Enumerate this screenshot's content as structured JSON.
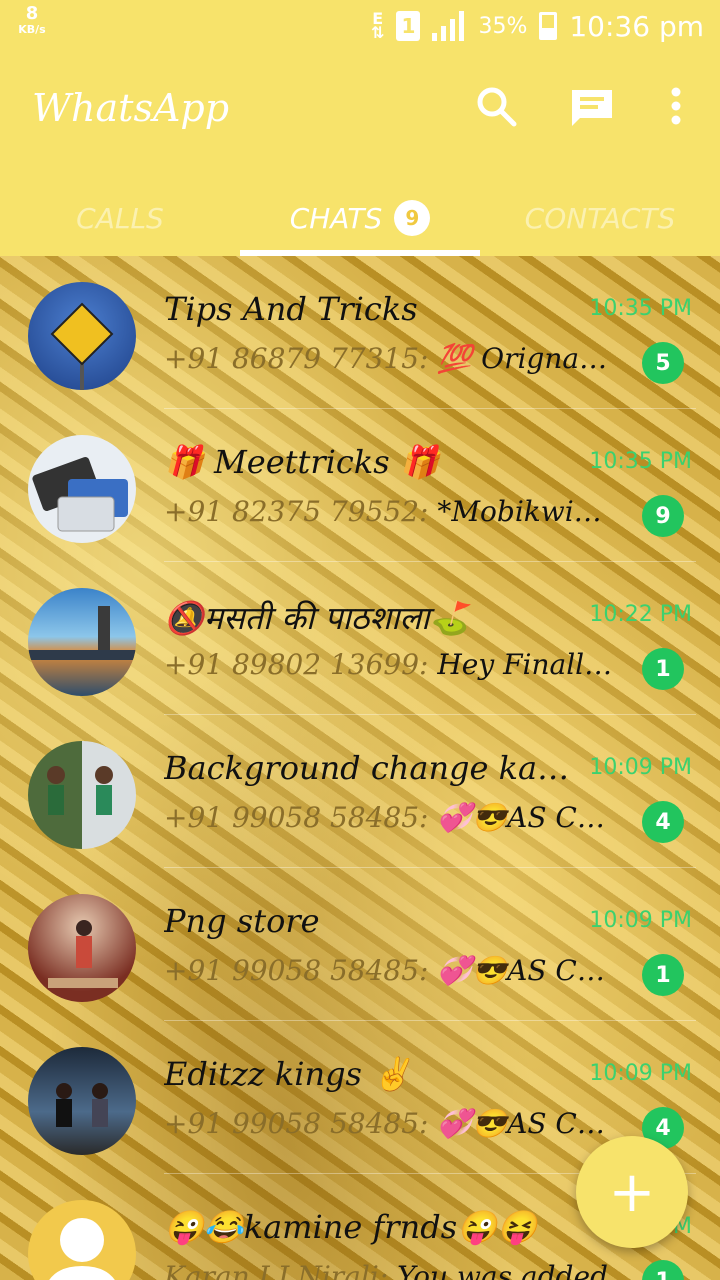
{
  "status_bar": {
    "speed_value": "8",
    "speed_unit": "KB/s",
    "network_type": "E",
    "sim_slot": "1",
    "battery_percent": "35%",
    "time": "10:36 pm"
  },
  "app_bar": {
    "title": "WhatsApp",
    "icons": [
      "search-icon",
      "new-chat-icon",
      "more-vert-icon"
    ]
  },
  "tabs": [
    {
      "label": "CALLS",
      "active": false
    },
    {
      "label": "CHATS",
      "active": true,
      "badge": "9"
    },
    {
      "label": "CONTACTS",
      "active": false
    }
  ],
  "chats": [
    {
      "name": "Tips And Tricks",
      "time": "10:35 PM",
      "sender": "+91 86879 77315:",
      "message": "💯 Orignal n...",
      "unread": "5"
    },
    {
      "name": "🎁 Meettricks 🎁",
      "time": "10:35 PM",
      "sender": "+91 82375 79552:",
      "message": "*Mobikwick A...",
      "unread": "9"
    },
    {
      "name": "🔕मसती की पाठशाला⛳",
      "time": "10:22 PM",
      "sender": "+91 89802 13699:",
      "message": "Hey Finally Se...",
      "unread": "1"
    },
    {
      "name": "Background change karn...",
      "time": "10:09 PM",
      "sender": "+91 99058 58485:",
      "message": "💞😎AS CRE...",
      "unread": "4"
    },
    {
      "name": "Png store",
      "time": "10:09 PM",
      "sender": "+91 99058 58485:",
      "message": "💞😎AS CRE...",
      "unread": "1"
    },
    {
      "name": "Editzz kings ✌",
      "time": "10:09 PM",
      "sender": "+91 99058 58485:",
      "message": "💞😎AS CRE...",
      "unread": "4"
    },
    {
      "name": "😜😂kamine frnds😜😝",
      "time": "PM",
      "sender": "Karan LJ Nirali:",
      "message": "You was added",
      "unread": "1"
    }
  ],
  "colors": {
    "accent": "#f7e36b",
    "unread_badge": "#22c55e",
    "time_green": "#3bd16f"
  }
}
